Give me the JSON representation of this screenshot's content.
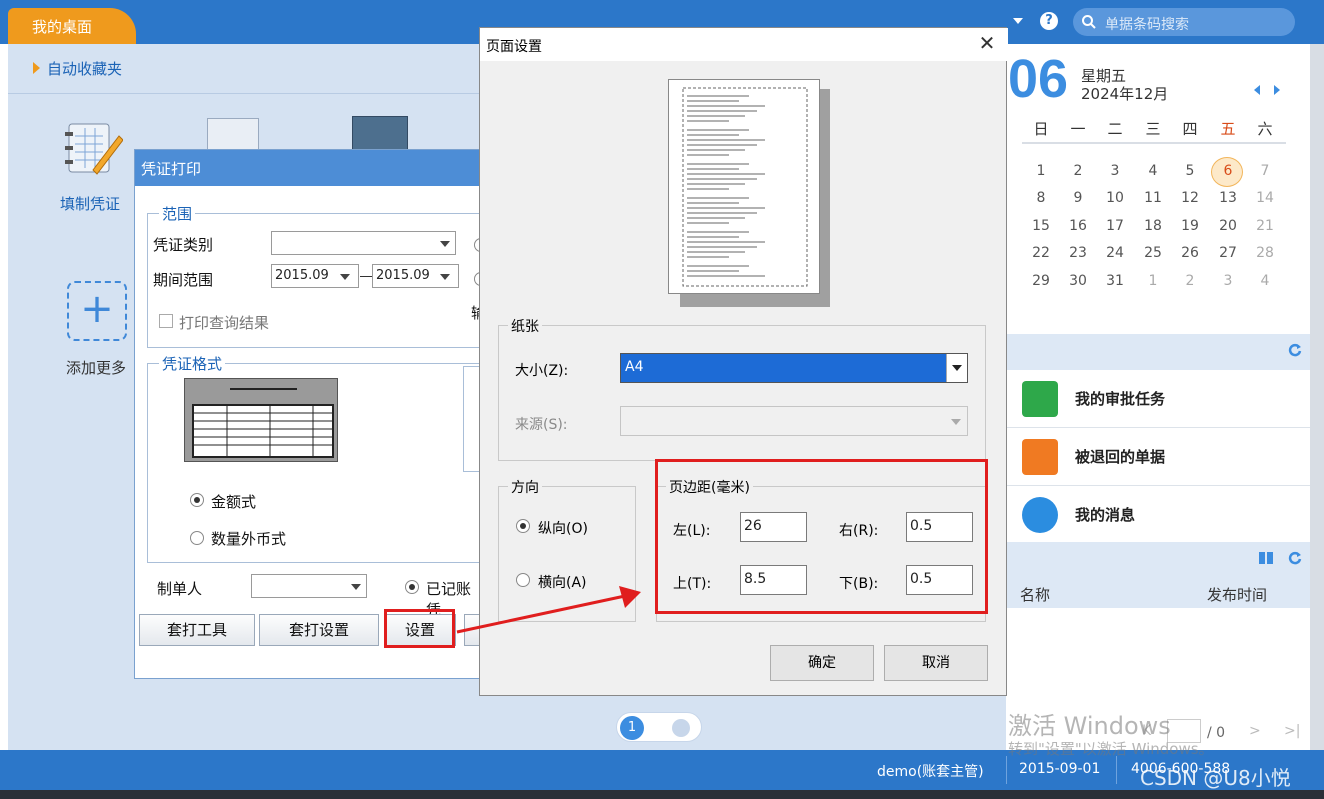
{
  "header": {
    "desk_tab": "我的桌面",
    "search_placeholder": "单据条码搜索"
  },
  "desktop": {
    "favorites_label": "自动收藏夹",
    "icons": [
      {
        "label": "填制凭证",
        "icon": "pencil-ledger-icon"
      },
      {
        "label": "添加更多",
        "icon": "plus-icon"
      }
    ]
  },
  "voucher_print": {
    "title": "凭证打印",
    "range_legend": "范围",
    "voucher_type_label": "凭证类别",
    "period_label": "期间范围",
    "period_from": "2015.09",
    "period_to": "2015.09",
    "print_query_result": "打印查询结果",
    "clipped_label": "输",
    "format_legend": "凭证格式",
    "format_amount": "金额式",
    "format_qty_fx": "数量外币式",
    "maker_label": "制单人",
    "posted_label": "已记账凭",
    "btn_tools": "套打工具",
    "btn_setup": "套打设置",
    "btn_settings": "设置"
  },
  "page_setup": {
    "title": "页面设置",
    "paper_legend": "纸张",
    "size_label": "大小(Z):",
    "size_value": "A4",
    "source_label": "来源(S):",
    "orientation_legend": "方向",
    "portrait": "纵向(O)",
    "landscape": "横向(A)",
    "margins_legend": "页边距(毫米)",
    "left_label": "左(L):",
    "left_value": "26",
    "right_label": "右(R):",
    "right_value": "0.5",
    "top_label": "上(T):",
    "top_value": "8.5",
    "bottom_label": "下(B):",
    "bottom_value": "0.5",
    "ok": "确定",
    "cancel": "取消"
  },
  "calendar": {
    "day": "06",
    "weekday": "星期五",
    "year_month": "2024年12月",
    "weekdays": [
      "日",
      "一",
      "二",
      "三",
      "四",
      "五",
      "六"
    ],
    "rows": [
      [
        "1",
        "2",
        "3",
        "4",
        "5",
        "6",
        "7"
      ],
      [
        "8",
        "9",
        "10",
        "11",
        "12",
        "13",
        "14"
      ],
      [
        "15",
        "16",
        "17",
        "18",
        "19",
        "20",
        "21"
      ],
      [
        "22",
        "23",
        "24",
        "25",
        "26",
        "27",
        "28"
      ],
      [
        "29",
        "30",
        "31",
        "1",
        "2",
        "3",
        "4"
      ]
    ]
  },
  "tasks": [
    {
      "label": "我的审批任务",
      "icon": "green-briefcase-icon"
    },
    {
      "label": "被退回的单据",
      "icon": "orange-document-icon"
    },
    {
      "label": "我的消息",
      "icon": "blue-chat-icon"
    }
  ],
  "news": {
    "col_name": "名称",
    "col_time": "发布时间",
    "page_of": "/ 0"
  },
  "footer": {
    "user": "demo(账套主管)",
    "date": "2015-09-01",
    "phone": "4006-600-588"
  },
  "overlay": {
    "activate_title": "激活 Windows",
    "activate_sub": "转到\"设置\"以激活 Windows。",
    "credit": "CSDN @U8小悦"
  },
  "colors": {
    "header_blue": "#2c77c9",
    "tab_orange": "#ef9a1d",
    "accent_blue": "#3c8de0",
    "highlight_red": "#e01e1e",
    "select_blue": "#1d6bd6"
  }
}
